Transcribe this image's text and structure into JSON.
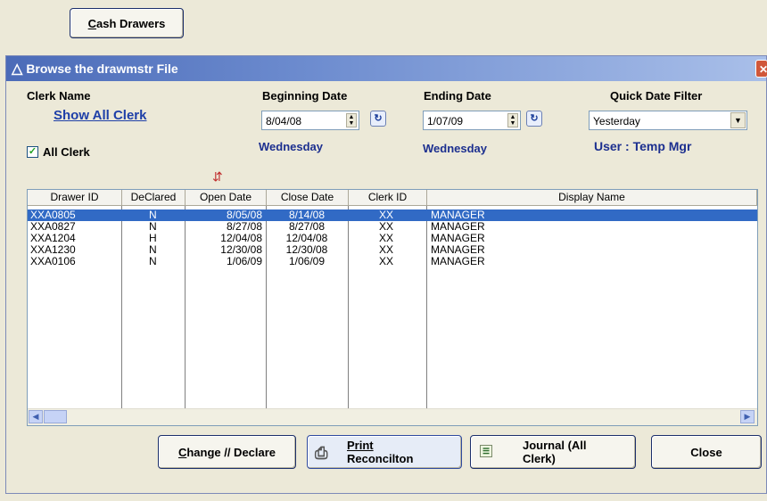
{
  "top_button": {
    "label_hotkey": "C",
    "label_rest": "ash Drawers"
  },
  "window": {
    "title": "Browse the drawmstr File",
    "title_icon": "triangle-icon"
  },
  "clerk": {
    "header": "Clerk Name",
    "link": "Show All Clerk",
    "checkbox_label": "All Clerk",
    "checkbox_checked": true
  },
  "beginning": {
    "header": "Beginning Date",
    "value": "8/04/08",
    "weekday": "Wednesday"
  },
  "ending": {
    "header": "Ending Date",
    "value": "1/07/09",
    "weekday": "Wednesday"
  },
  "quick_filter": {
    "header": "Quick Date Filter",
    "value": "Yesterday"
  },
  "user": {
    "label": "User : Temp Mgr"
  },
  "grid": {
    "columns": [
      "Drawer ID",
      "DeClared",
      "Open Date",
      "Close Date",
      "Clerk ID",
      "Display Name"
    ],
    "rows": [
      [
        "XXA0805",
        "N",
        "8/05/08",
        "8/14/08",
        "XX",
        "MANAGER"
      ],
      [
        "XXA0827",
        "N",
        "8/27/08",
        "8/27/08",
        "XX",
        "MANAGER"
      ],
      [
        "XXA1204",
        "H",
        "12/04/08",
        "12/04/08",
        "XX",
        "MANAGER"
      ],
      [
        "XXA1230",
        "N",
        "12/30/08",
        "12/30/08",
        "XX",
        "MANAGER"
      ],
      [
        "XXA0106",
        "N",
        "1/06/09",
        "1/06/09",
        "XX",
        "MANAGER"
      ]
    ],
    "selected_row": 0
  },
  "buttons": {
    "change_hotkey": "C",
    "change_rest": "hange // Declare",
    "print_line1": "Print",
    "print_line2": "Reconcilton",
    "journal_line1": "Journal (All",
    "journal_line2": "Clerk)",
    "close": "Close"
  },
  "colors": {
    "selection": "#316ac5",
    "title_blue": "#1c2f8f",
    "link_blue": "#1e3fa8"
  }
}
